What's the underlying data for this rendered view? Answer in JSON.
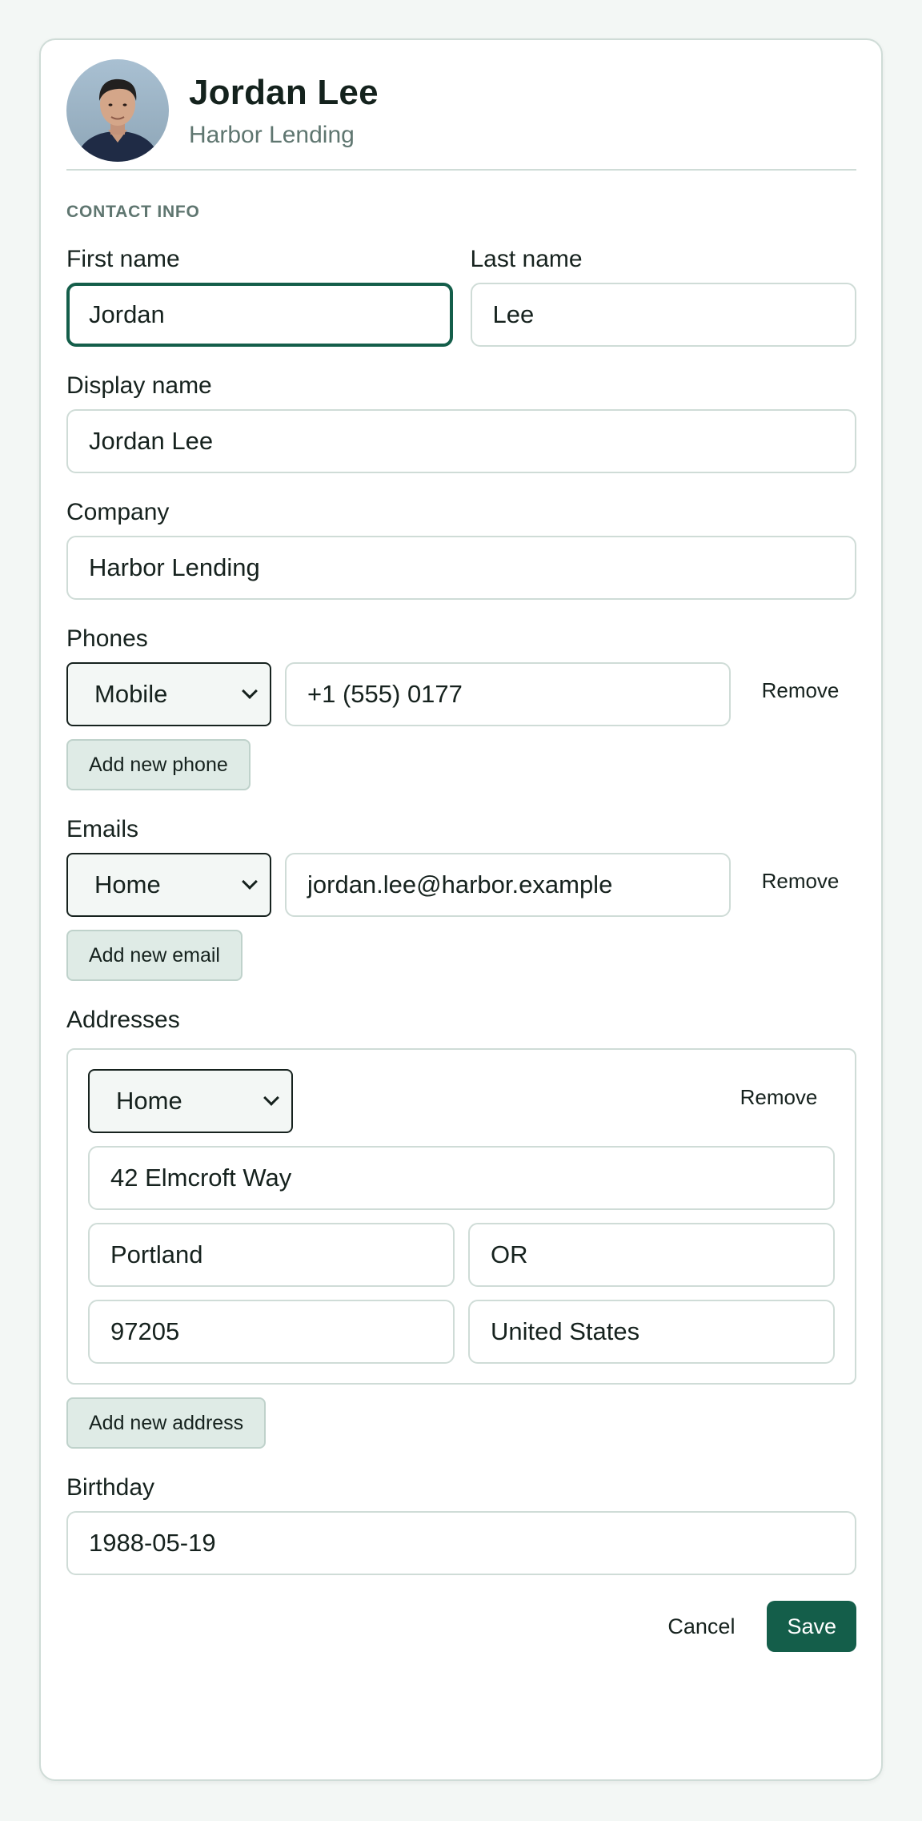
{
  "header": {
    "name": "Jordan Lee",
    "company": "Harbor Lending"
  },
  "section": {
    "title": "CONTACT INFO"
  },
  "fields": {
    "first_name": {
      "label": "First name",
      "value": "Jordan"
    },
    "last_name": {
      "label": "Last name",
      "value": "Lee"
    },
    "display_name": {
      "label": "Display name",
      "value": "Jordan Lee"
    },
    "company": {
      "label": "Company",
      "value": "Harbor Lending"
    },
    "birthday": {
      "label": "Birthday",
      "value": "1988-05-19"
    }
  },
  "phones": {
    "label": "Phones",
    "items": [
      {
        "type": "Mobile",
        "value": "+1 (555) 0177",
        "remove": "Remove"
      }
    ],
    "add_label": "Add new phone"
  },
  "emails": {
    "label": "Emails",
    "items": [
      {
        "type": "Home",
        "value": "jordan.lee@harbor.example",
        "remove": "Remove"
      }
    ],
    "add_label": "Add new email"
  },
  "addresses": {
    "label": "Addresses",
    "items": [
      {
        "type": "Home",
        "remove": "Remove",
        "street": "42 Elmcroft Way",
        "city": "Portland",
        "state": "OR",
        "zip": "97205",
        "country": "United States"
      }
    ],
    "add_label": "Add new address"
  },
  "actions": {
    "cancel": "Cancel",
    "save": "Save"
  },
  "colors": {
    "accent": "#145e4a",
    "border": "#cfdcd7",
    "add_button_bg": "#dfebe6",
    "page_bg": "#f3f7f5"
  },
  "icons": {
    "select_caret": "chevron-down-icon"
  }
}
